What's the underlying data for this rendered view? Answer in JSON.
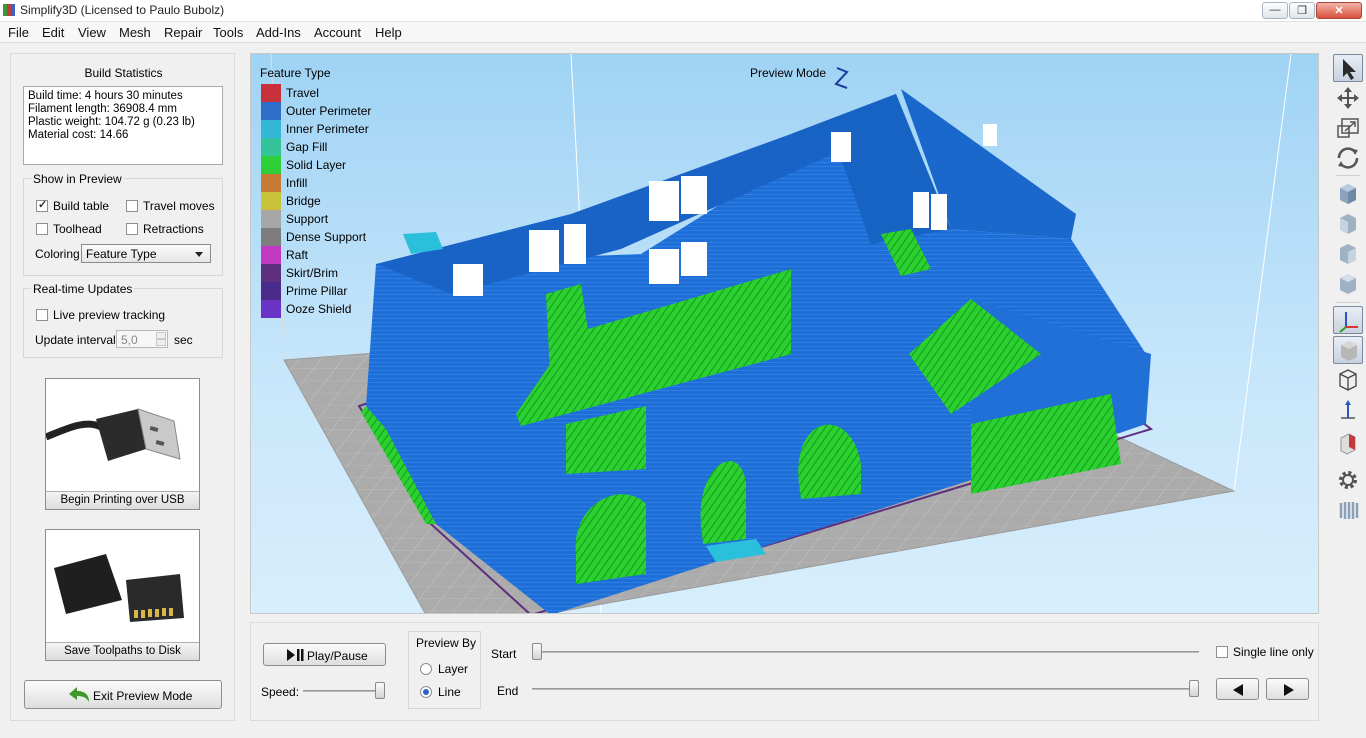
{
  "window": {
    "title": "Simplify3D (Licensed to Paulo Bubolz)",
    "min_glyph": "—",
    "max_glyph": "❐",
    "close_glyph": "✕"
  },
  "menu": [
    "File",
    "Edit",
    "View",
    "Mesh",
    "Repair",
    "Tools",
    "Add-Ins",
    "Account",
    "Help"
  ],
  "build_statistics": {
    "title": "Build Statistics",
    "lines": [
      "Build time: 4 hours 30 minutes",
      "Filament length: 36908.4 mm",
      "Plastic weight: 104.72 g (0.23 lb)",
      "Material cost: 14.66"
    ]
  },
  "show_in_preview": {
    "title": "Show in Preview",
    "build_table": {
      "label": "Build table",
      "checked": true
    },
    "travel_moves": {
      "label": "Travel moves",
      "checked": false
    },
    "toolhead": {
      "label": "Toolhead",
      "checked": false
    },
    "retractions": {
      "label": "Retractions",
      "checked": false
    },
    "coloring_label": "Coloring",
    "coloring_value": "Feature Type"
  },
  "realtime": {
    "title": "Real-time Updates",
    "live_label": "Live preview tracking",
    "live_checked": false,
    "interval_label": "Update interval",
    "interval_value": "5,0",
    "interval_unit": "sec"
  },
  "buttons": {
    "usb": "Begin Printing over USB",
    "disk": "Save Toolpaths to Disk",
    "exit": "Exit Preview Mode"
  },
  "viewport": {
    "legend_title": "Feature Type",
    "preview_mode": "Preview Mode",
    "legend": [
      {
        "name": "Travel",
        "color": "#c8313a"
      },
      {
        "name": "Outer Perimeter",
        "color": "#2e6ec9"
      },
      {
        "name": "Inner Perimeter",
        "color": "#33b7d6"
      },
      {
        "name": "Gap Fill",
        "color": "#35c49a"
      },
      {
        "name": "Solid Layer",
        "color": "#2fcf3a"
      },
      {
        "name": "Infill",
        "color": "#c77a33"
      },
      {
        "name": "Bridge",
        "color": "#c9c23a"
      },
      {
        "name": "Support",
        "color": "#a7a7a7"
      },
      {
        "name": "Dense Support",
        "color": "#7d7d7d"
      },
      {
        "name": "Raft",
        "color": "#c239c2"
      },
      {
        "name": "Skirt/Brim",
        "color": "#5e2f7d"
      },
      {
        "name": "Prime Pillar",
        "color": "#4a2b8c"
      },
      {
        "name": "Ooze Shield",
        "color": "#6a33c4"
      }
    ]
  },
  "playback": {
    "play_label": "Play/Pause",
    "speed_label": "Speed:",
    "speed_level": 1.0,
    "preview_by_title": "Preview By",
    "layer_label": "Layer",
    "line_label": "Line",
    "selected": "Line",
    "start_label": "Start",
    "end_label": "End",
    "start_position": 0.0,
    "end_position": 1.0,
    "single_line_label": "Single line only",
    "single_line_checked": false
  },
  "toolbar": [
    "select-icon",
    "move-icon",
    "scale-icon",
    "rotate-icon",
    "view-default-icon",
    "view-front-icon",
    "view-side-icon",
    "view-top-icon",
    "axes-icon",
    "solid-icon",
    "wireframe-icon",
    "normals-icon",
    "section-icon",
    "settings-icon",
    "toolpaths-icon"
  ]
}
